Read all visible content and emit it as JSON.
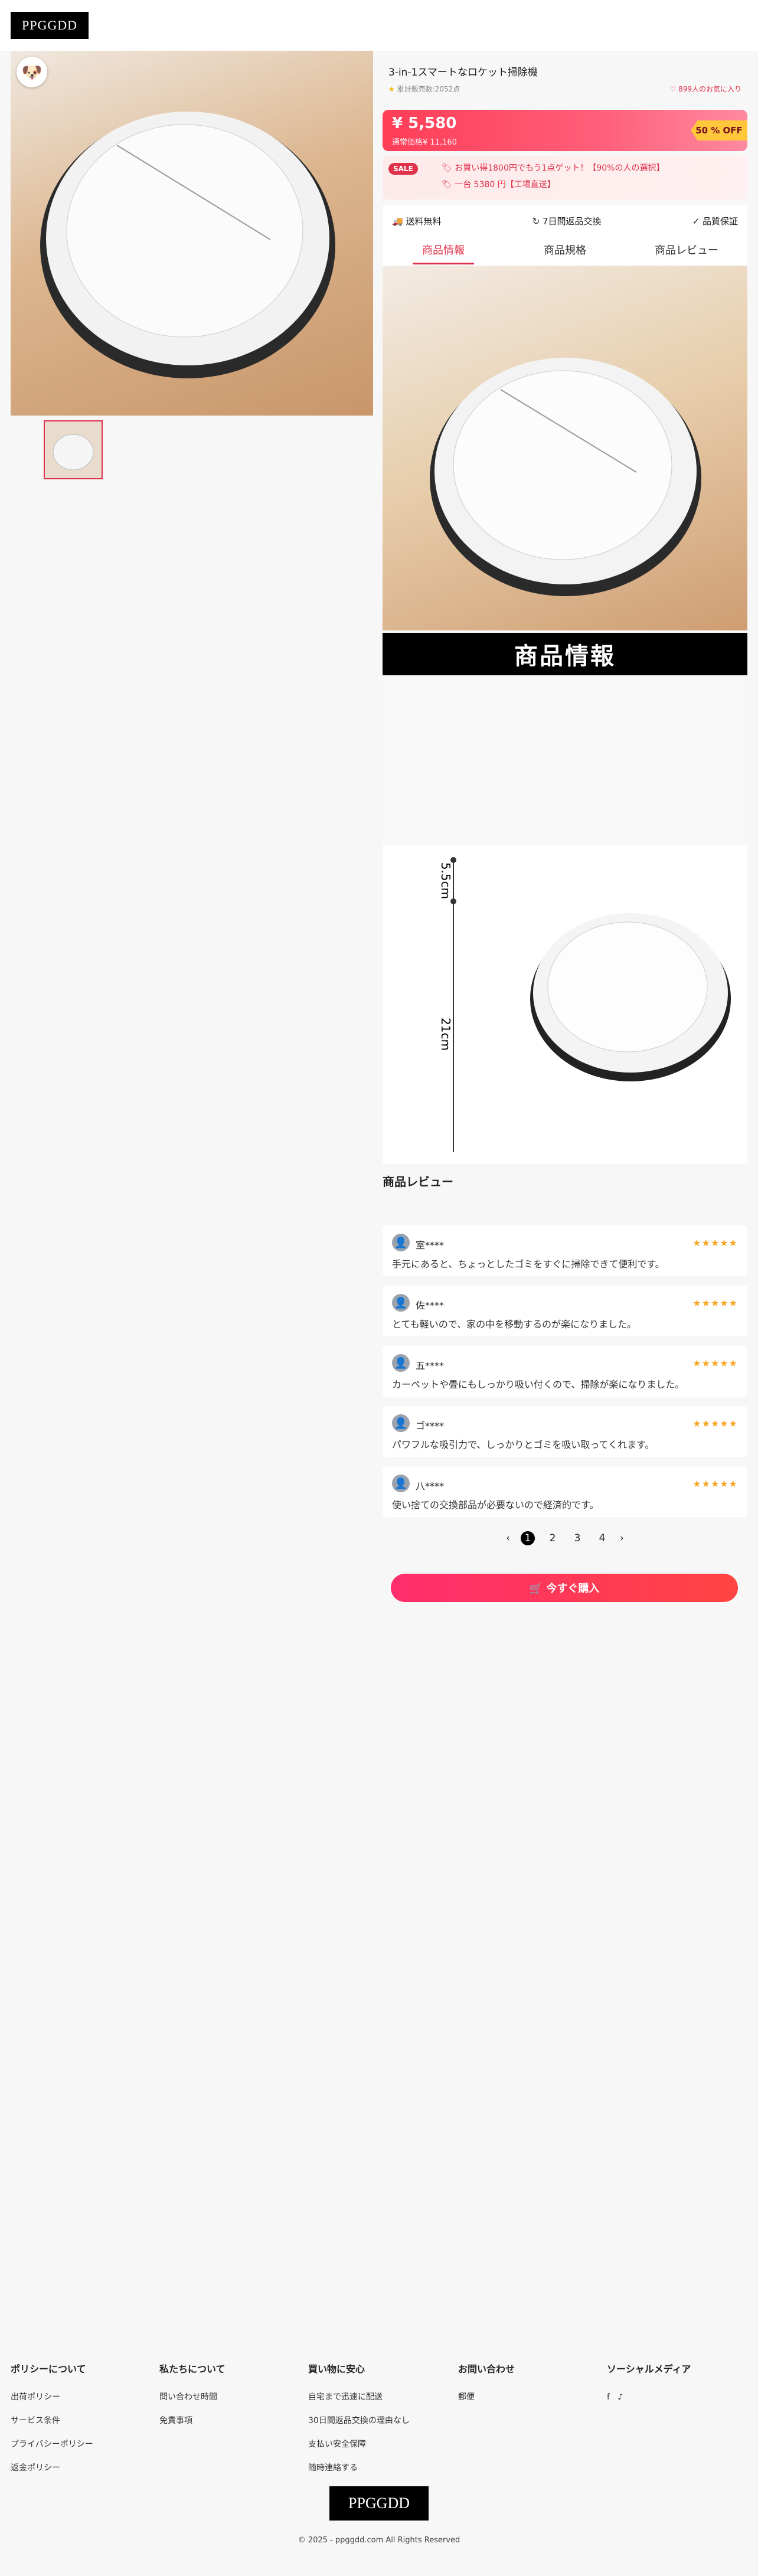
{
  "header": {
    "logo_text": "PPGGDD"
  },
  "product": {
    "title": "3-in-1スマートなロケット掃除機",
    "sold": "累計販売数:2052点",
    "favorites": "899人のお気に入り",
    "price": "¥ 5,580",
    "original_price": "通常価格¥ 11,160",
    "discount": "50 % OFF",
    "sale_badge": "SALE",
    "promo1": "お買い得1800円でもう1点ゲット！【90%の人の選択】",
    "promo2": "一台 5380 円【工場直送】",
    "features": [
      "送料無料",
      "7日間返品交換",
      "品質保証"
    ],
    "tabs": [
      "商品情報",
      "商品規格",
      "商品レビュー"
    ],
    "banner": "商品情報",
    "dim_height": "5.5cm",
    "dim_diameter": "21cm"
  },
  "reviews": {
    "title": "商品レビュー",
    "stars": "★★★★★",
    "items": [
      {
        "name": "室****",
        "text": "手元にあると、ちょっとしたゴミをすぐに掃除できて便利です。"
      },
      {
        "name": "佐****",
        "text": "とても軽いので、家の中を移動するのが楽になりました。"
      },
      {
        "name": "五****",
        "text": "カーペットや畳にもしっかり吸い付くので、掃除が楽になりました。"
      },
      {
        "name": "ゴ****",
        "text": "パワフルな吸引力で、しっかりとゴミを吸い取ってくれます。"
      },
      {
        "name": "八****",
        "text": "使い捨ての交換部品が必要ないので経済的です。"
      }
    ],
    "pages": [
      "1",
      "2",
      "3",
      "4"
    ]
  },
  "buy_label": "🛒 今すぐ購入",
  "footer": {
    "cols": [
      {
        "title": "ポリシーについて",
        "links": [
          "出荷ポリシー",
          "サービス条件",
          "プライバシーポリシー",
          "返金ポリシー"
        ]
      },
      {
        "title": "私たちについて",
        "links": [
          "問い合わせ時間",
          "免責事項"
        ]
      },
      {
        "title": "買い物に安心",
        "links": [
          "自宅まで迅速に配送",
          "30日間返品交換の理由なし",
          "支払い安全保障",
          "随時連絡する"
        ]
      },
      {
        "title": "お問い合わせ",
        "links": [
          "郵便"
        ]
      },
      {
        "title": "ソーシャルメディア",
        "links": []
      }
    ],
    "logo_text": "PPGGDD",
    "copyright": "© 2025 - ppggdd.com All Rights Reserved"
  }
}
